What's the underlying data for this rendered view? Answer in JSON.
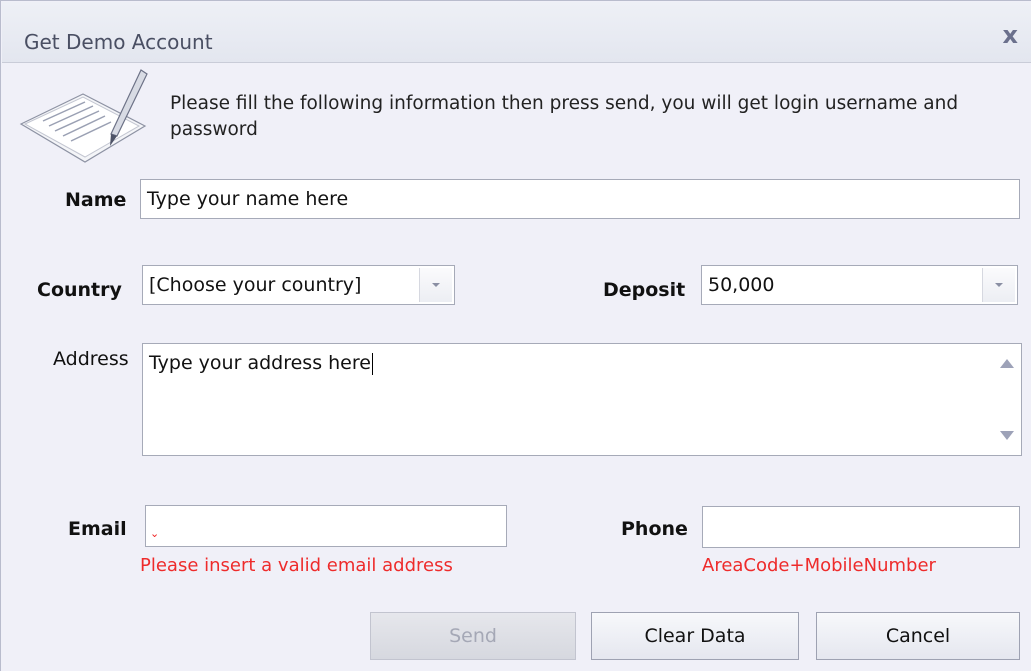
{
  "window": {
    "title": "Get Demo Account",
    "close_glyph": "x"
  },
  "intro": {
    "icon": "document-pen-icon",
    "text": "Please fill the following information then press send, you will get login username and password"
  },
  "form": {
    "name": {
      "label": "Name",
      "value": "Type your name here"
    },
    "country": {
      "label": "Country",
      "value": "[Choose your country]"
    },
    "deposit": {
      "label": "Deposit",
      "value": "50,000"
    },
    "address": {
      "label": "Address",
      "value": "Type your address here"
    },
    "email": {
      "label": "Email",
      "value": "",
      "error": "Please insert a valid email address"
    },
    "phone": {
      "label": "Phone",
      "value": "",
      "hint": "AreaCode+MobileNumber"
    }
  },
  "buttons": {
    "send": "Send",
    "clear": "Clear Data",
    "cancel": "Cancel"
  },
  "colors": {
    "error": "#ee2b2b",
    "window_bg": "#f0f0f8"
  }
}
